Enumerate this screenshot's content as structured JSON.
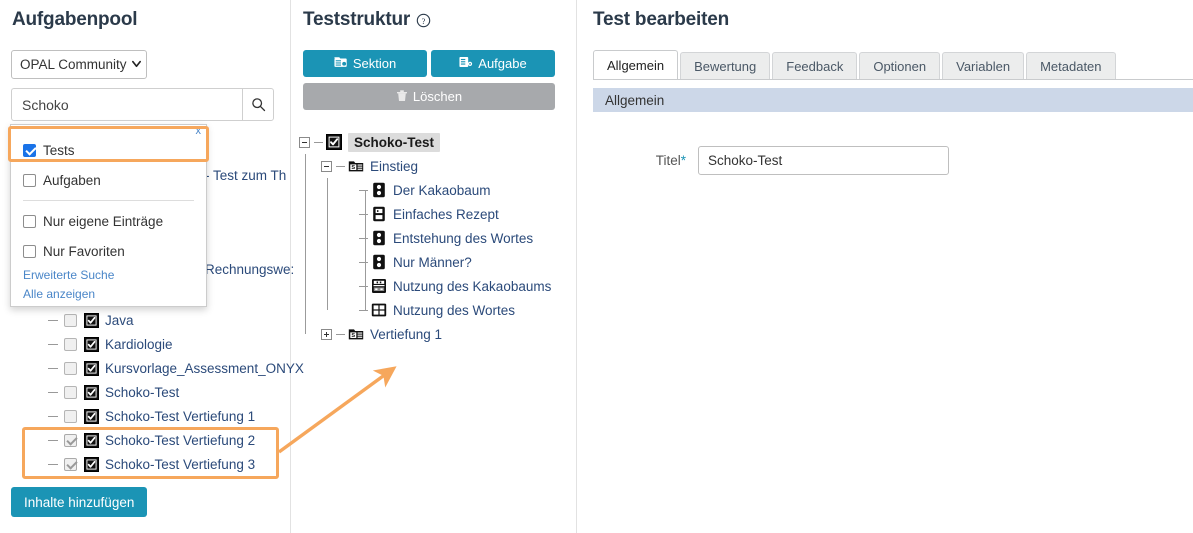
{
  "left": {
    "title": "Aufgabenpool",
    "source_select": {
      "value": "OPAL Community",
      "icon": "chevron-down-icon"
    },
    "search": {
      "value": "Schoko",
      "placeholder": "",
      "icon": "search-icon"
    },
    "filter_panel": {
      "close_label": "x",
      "options": [
        {
          "label": "Tests",
          "checked": true
        },
        {
          "label": "Aufgaben",
          "checked": false
        },
        {
          "label": "Nur eigene Einträge",
          "checked": false
        },
        {
          "label": "Nur Favoriten",
          "checked": false
        }
      ],
      "links": [
        "Erweiterte Suche",
        "Alle anzeigen"
      ]
    },
    "background_results": [
      {
        "text": "- Test zum Th"
      },
      {
        "text": "Rechnungswe:"
      }
    ],
    "tree_items": [
      {
        "label": "Java",
        "select_checked": false,
        "type_icon": "test-checkbox-icon"
      },
      {
        "label": "Kardiologie",
        "select_checked": false,
        "type_icon": "test-checkbox-icon"
      },
      {
        "label": "Kursvorlage_Assessment_ONYX",
        "select_checked": false,
        "type_icon": "test-checkbox-icon"
      },
      {
        "label": "Schoko-Test",
        "select_checked": false,
        "type_icon": "test-checkbox-icon"
      },
      {
        "label": "Schoko-Test Vertiefung 1",
        "select_checked": false,
        "type_icon": "test-checkbox-icon"
      },
      {
        "label": "Schoko-Test Vertiefung 2",
        "select_checked": true,
        "type_icon": "test-checkbox-icon"
      },
      {
        "label": "Schoko-Test Vertiefung 3",
        "select_checked": true,
        "type_icon": "test-checkbox-icon"
      }
    ],
    "add_button": "Inhalte hinzufügen"
  },
  "middle": {
    "title": "Teststruktur",
    "help_icon": "help-circle-icon",
    "buttons": [
      {
        "label": "Sektion",
        "icon": "section-icon",
        "disabled": false
      },
      {
        "label": "Aufgabe",
        "icon": "task-icon",
        "disabled": false
      },
      {
        "label": "Löschen",
        "icon": "trash-icon",
        "disabled": true
      }
    ],
    "tree": {
      "root": {
        "label": "Schoko-Test",
        "icon": "test-checkbox-icon",
        "expanded": true
      },
      "sections": [
        {
          "label": "Einstieg",
          "icon": "section-folder-icon",
          "expanded": true,
          "items": [
            {
              "label": "Der Kakaobaum",
              "icon": "single-choice-icon"
            },
            {
              "label": "Einfaches Rezept",
              "icon": "text-entry-icon"
            },
            {
              "label": "Entstehung des Wortes",
              "icon": "single-choice-icon"
            },
            {
              "label": "Nur Männer?",
              "icon": "single-choice-icon"
            },
            {
              "label": "Nutzung des Kakaobaums",
              "icon": "match-icon"
            },
            {
              "label": "Nutzung des Wortes",
              "icon": "multiple-choice-icon"
            }
          ]
        },
        {
          "label": "Vertiefung 1",
          "icon": "section-folder-icon",
          "expanded": false,
          "items": []
        }
      ]
    }
  },
  "right": {
    "title": "Test bearbeiten",
    "tabs": [
      {
        "label": "Allgemein",
        "active": true
      },
      {
        "label": "Bewertung",
        "active": false
      },
      {
        "label": "Feedback",
        "active": false
      },
      {
        "label": "Optionen",
        "active": false
      },
      {
        "label": "Variablen",
        "active": false
      },
      {
        "label": "Metadaten",
        "active": false
      }
    ],
    "section_header": "Allgemein",
    "form": {
      "title_label": "Titel",
      "required_marker": "*",
      "title_value": "Schoko-Test",
      "title_placeholder": ""
    }
  },
  "annotations": {
    "highlight_color": "#f6a75c",
    "boxes": [
      "filter-tests-row",
      "selected-tree-rows"
    ],
    "arrow": "points-from-selected-rows-to-test-structure-tree"
  }
}
